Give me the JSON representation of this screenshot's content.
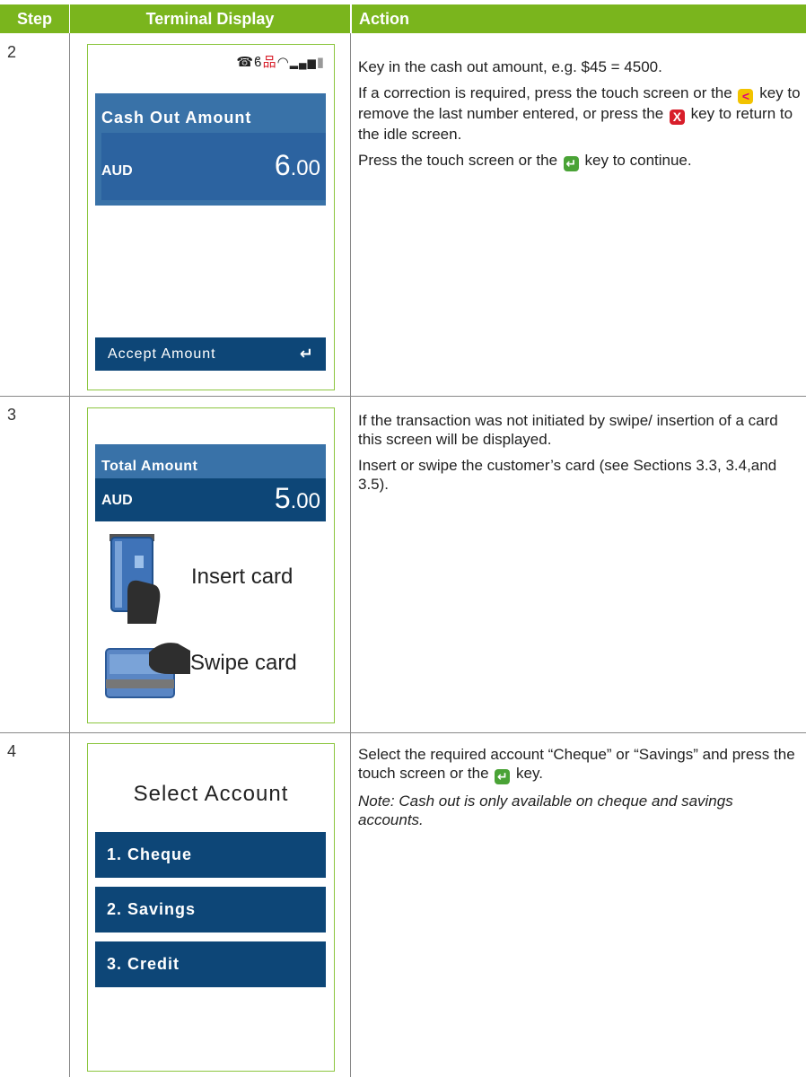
{
  "headers": {
    "step": "Step",
    "terminal": "Terminal Display",
    "action": "Action"
  },
  "rows": [
    {
      "step": "2",
      "screen": {
        "status_icons": [
          "phone-icon",
          "bluetooth-icon",
          "network-icon",
          "wifi-icon",
          "signal-icon",
          "battery-icon"
        ],
        "title": "Cash Out Amount",
        "currency": "AUD",
        "amount_main": "6",
        "amount_dec": ".00",
        "button": "Accept Amount"
      },
      "action": {
        "p1": "Key in the cash out amount, e.g. $45 = 4500.",
        "p2a": "If a correction is required, press the touch screen or the",
        "p2b": "key to remove the last number entered, or press the",
        "p2c": "key to return to the idle screen.",
        "p3a": "Press the touch screen or the",
        "p3b": "key to continue."
      }
    },
    {
      "step": "3",
      "screen": {
        "title": "Total Amount",
        "currency": "AUD",
        "amount_main": "5",
        "amount_dec": ".00",
        "insert": "Insert card",
        "swipe": "Swipe card"
      },
      "action": {
        "p1": "If the transaction was not initiated by swipe/ insertion of a card this screen will be displayed.",
        "p2": "Insert or swipe the customer’s card (see Sections 3.3, 3.4,and 3.5)."
      }
    },
    {
      "step": "4",
      "screen": {
        "title": "Select Account",
        "options": [
          "1. Cheque",
          "2. Savings",
          "3. Credit"
        ]
      },
      "action": {
        "p1a": "Select the required account “Cheque” or “Savings” and press the touch screen or the",
        "p1b": "key.",
        "note": "Note: Cash out is only available on cheque and savings accounts."
      }
    }
  ],
  "colors": {
    "header_green": "#7ab51d",
    "panel_light": "#3972a8",
    "panel_dark": "#0d4677",
    "screen_border": "#8cc63f"
  }
}
